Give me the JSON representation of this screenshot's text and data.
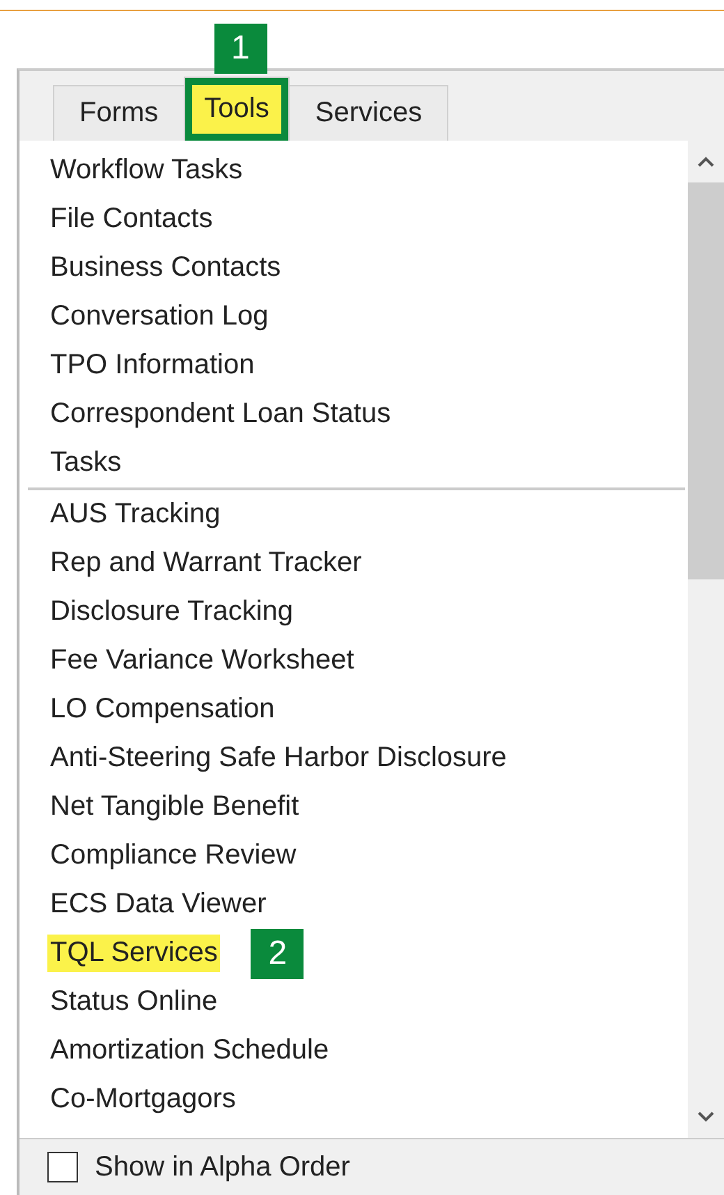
{
  "tabs": [
    {
      "label": "Forms",
      "selected": false,
      "highlighted": false
    },
    {
      "label": "Tools",
      "selected": true,
      "highlighted": true,
      "callout": "1"
    },
    {
      "label": "Services",
      "selected": false,
      "highlighted": false
    }
  ],
  "groups": [
    {
      "items": [
        {
          "label": "Workflow Tasks",
          "highlighted": false
        },
        {
          "label": "File Contacts",
          "highlighted": false
        },
        {
          "label": "Business Contacts",
          "highlighted": false
        },
        {
          "label": "Conversation Log",
          "highlighted": false
        },
        {
          "label": "TPO Information",
          "highlighted": false
        },
        {
          "label": "Correspondent Loan Status",
          "highlighted": false
        },
        {
          "label": "Tasks",
          "highlighted": false
        }
      ]
    },
    {
      "items": [
        {
          "label": "AUS Tracking",
          "highlighted": false
        },
        {
          "label": "Rep and Warrant Tracker",
          "highlighted": false
        },
        {
          "label": "Disclosure Tracking",
          "highlighted": false
        },
        {
          "label": "Fee Variance Worksheet",
          "highlighted": false
        },
        {
          "label": "LO Compensation",
          "highlighted": false
        },
        {
          "label": "Anti-Steering Safe Harbor Disclosure",
          "highlighted": false
        },
        {
          "label": "Net Tangible Benefit",
          "highlighted": false
        },
        {
          "label": "Compliance Review",
          "highlighted": false
        },
        {
          "label": "ECS Data Viewer",
          "highlighted": false
        },
        {
          "label": "TQL Services",
          "highlighted": true,
          "callout": "2"
        },
        {
          "label": "Status Online",
          "highlighted": false
        },
        {
          "label": "Amortization Schedule",
          "highlighted": false
        },
        {
          "label": "Co-Mortgagors",
          "highlighted": false
        }
      ]
    }
  ],
  "alpha_order": {
    "label": "Show in Alpha Order",
    "checked": false
  }
}
